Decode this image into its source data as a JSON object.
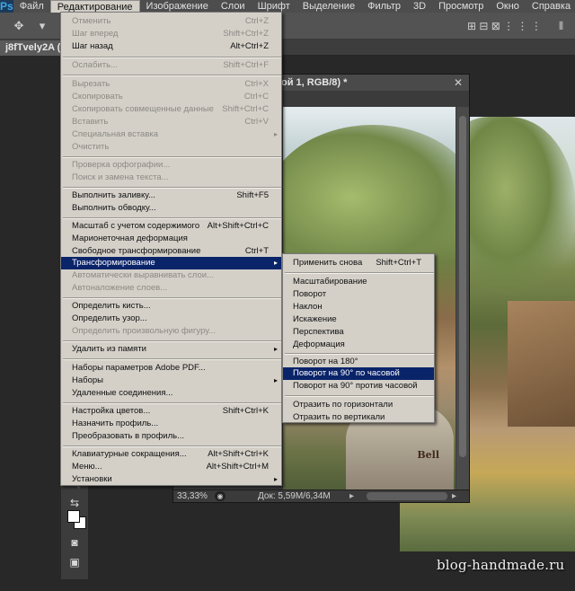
{
  "menubar": {
    "logo": "Ps",
    "items": [
      "Файл",
      "Редактирование",
      "Изображение",
      "Слои",
      "Шрифт",
      "Выделение",
      "Фильтр",
      "3D",
      "Просмотр",
      "Окно",
      "Справка"
    ]
  },
  "document_tab": {
    "label": "j8fTvely2A (1"
  },
  "document_window": {
    "title": "ой 1, RGB/8) *",
    "zoom": "33,33%",
    "doc_info": "Док: 5,59M/6,34M",
    "signature": "Bell"
  },
  "edit_menu": {
    "items": [
      {
        "label": "Отменить",
        "shortcut": "Ctrl+Z",
        "enabled": false
      },
      {
        "label": "Шаг вперед",
        "shortcut": "Shift+Ctrl+Z",
        "enabled": false
      },
      {
        "label": "Шаг назад",
        "shortcut": "Alt+Ctrl+Z",
        "enabled": true
      },
      {
        "label": "Ослабить...",
        "shortcut": "Shift+Ctrl+F",
        "enabled": false
      },
      {
        "label": "Вырезать",
        "shortcut": "Ctrl+X",
        "enabled": false
      },
      {
        "label": "Скопировать",
        "shortcut": "Ctrl+C",
        "enabled": false
      },
      {
        "label": "Скопировать совмещенные данные",
        "shortcut": "Shift+Ctrl+C",
        "enabled": false
      },
      {
        "label": "Вставить",
        "shortcut": "Ctrl+V",
        "enabled": false
      },
      {
        "label": "Специальная вставка",
        "shortcut": "",
        "enabled": false
      },
      {
        "label": "Очистить",
        "shortcut": "",
        "enabled": false
      },
      {
        "label": "Проверка орфографии...",
        "shortcut": "",
        "enabled": false
      },
      {
        "label": "Поиск и замена текста...",
        "shortcut": "",
        "enabled": false
      },
      {
        "label": "Выполнить заливку...",
        "shortcut": "Shift+F5",
        "enabled": true
      },
      {
        "label": "Выполнить обводку...",
        "shortcut": "",
        "enabled": true
      },
      {
        "label": "Масштаб с учетом содержимого",
        "shortcut": "Alt+Shift+Ctrl+C",
        "enabled": true
      },
      {
        "label": "Марионеточная деформация",
        "shortcut": "",
        "enabled": true
      },
      {
        "label": "Свободное трансформирование",
        "shortcut": "Ctrl+T",
        "enabled": true
      },
      {
        "label": "Трансформирование",
        "shortcut": "",
        "enabled": true
      },
      {
        "label": "Автоматически выравнивать слои...",
        "shortcut": "",
        "enabled": false
      },
      {
        "label": "Автоналожение слоев...",
        "shortcut": "",
        "enabled": false
      },
      {
        "label": "Определить кисть...",
        "shortcut": "",
        "enabled": true
      },
      {
        "label": "Определить узор...",
        "shortcut": "",
        "enabled": true
      },
      {
        "label": "Определить произвольную фигуру...",
        "shortcut": "",
        "enabled": false
      },
      {
        "label": "Удалить из памяти",
        "shortcut": "",
        "enabled": true
      },
      {
        "label": "Наборы параметров Adobe PDF...",
        "shortcut": "",
        "enabled": true
      },
      {
        "label": "Наборы",
        "shortcut": "",
        "enabled": true
      },
      {
        "label": "Удаленные соединения...",
        "shortcut": "",
        "enabled": true
      },
      {
        "label": "Настройка цветов...",
        "shortcut": "Shift+Ctrl+K",
        "enabled": true
      },
      {
        "label": "Назначить профиль...",
        "shortcut": "",
        "enabled": true
      },
      {
        "label": "Преобразовать в профиль...",
        "shortcut": "",
        "enabled": true
      },
      {
        "label": "Клавиатурные сокращения...",
        "shortcut": "Alt+Shift+Ctrl+K",
        "enabled": true
      },
      {
        "label": "Меню...",
        "shortcut": "Alt+Shift+Ctrl+M",
        "enabled": true
      },
      {
        "label": "Установки",
        "shortcut": "",
        "enabled": true
      }
    ]
  },
  "transform_submenu": {
    "items": [
      {
        "label": "Применить снова",
        "shortcut": "Shift+Ctrl+T"
      },
      {
        "label": "Масштабирование",
        "shortcut": ""
      },
      {
        "label": "Поворот",
        "shortcut": ""
      },
      {
        "label": "Наклон",
        "shortcut": ""
      },
      {
        "label": "Искажение",
        "shortcut": ""
      },
      {
        "label": "Перспектива",
        "shortcut": ""
      },
      {
        "label": "Деформация",
        "shortcut": ""
      },
      {
        "label": "Поворот на 180°",
        "shortcut": ""
      },
      {
        "label": "Поворот на 90° по часовой",
        "shortcut": ""
      },
      {
        "label": "Поворот на 90° против часовой",
        "shortcut": ""
      },
      {
        "label": "Отразить по горизонтали",
        "shortcut": ""
      },
      {
        "label": "Отразить по вертикали",
        "shortcut": ""
      }
    ]
  },
  "watermark": "blog-handmade.ru",
  "colors": {
    "menu_bg": "#d4d0c8",
    "highlight": "#0a246a",
    "disabled_text": "#8c8a84"
  }
}
